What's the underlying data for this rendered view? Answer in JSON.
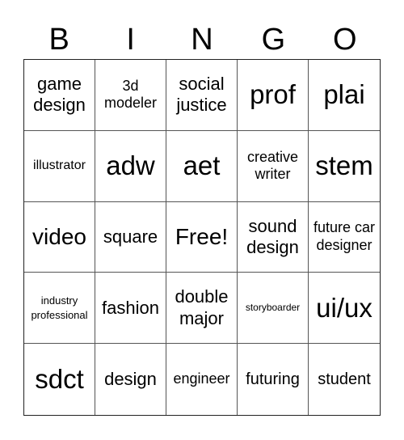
{
  "card": {
    "header": [
      "B",
      "I",
      "N",
      "G",
      "O"
    ],
    "cells": [
      [
        "game design",
        "3d modeler",
        "social justice",
        "prof",
        "plai"
      ],
      [
        "illustrator",
        "adw",
        "aet",
        "creative writer",
        "stem"
      ],
      [
        "video",
        "square",
        "Free!",
        "sound design",
        "future car designer"
      ],
      [
        "industry professional",
        "fashion",
        "double major",
        "storyboarder",
        "ui/ux"
      ],
      [
        "sdct",
        "design",
        "engineer",
        "futuring",
        "student"
      ]
    ]
  }
}
